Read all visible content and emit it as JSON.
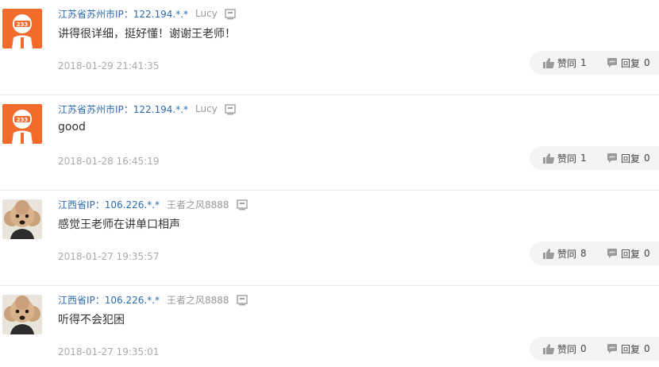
{
  "comments": [
    {
      "location": "江苏省苏州市IP：122.194.*.*",
      "username": "Lucy",
      "avatar_icon": "bilibili-233-avatar-icon",
      "content": "讲得很详细，挺好懂！谢谢王老师！",
      "time": "2018-01-29 21:41:35",
      "like_label": "赞同",
      "like_count": "1",
      "reply_label": "回复",
      "reply_count": "0"
    },
    {
      "location": "江苏省苏州市IP：122.194.*.*",
      "username": "Lucy",
      "avatar_icon": "bilibili-233-avatar-icon",
      "content": "good",
      "time": "2018-01-28 16:45:19",
      "like_label": "赞同",
      "like_count": "1",
      "reply_label": "回复",
      "reply_count": "0"
    },
    {
      "location": "江西省IP：106.226.*.*",
      "username": "王者之风8888",
      "avatar_icon": "poodle-dog-avatar-icon",
      "content": "感觉王老师在讲单口相声",
      "time": "2018-01-27 19:35:57",
      "like_label": "赞同",
      "like_count": "8",
      "reply_label": "回复",
      "reply_count": "0"
    },
    {
      "location": "江西省IP：106.226.*.*",
      "username": "王者之风8888",
      "avatar_icon": "poodle-dog-avatar-icon",
      "content": "听得不会犯困",
      "time": "2018-01-27 19:35:01",
      "like_label": "赞同",
      "like_count": "0",
      "reply_label": "回复",
      "reply_count": "0"
    }
  ],
  "colors": {
    "location_link": "#2b6bb0",
    "avatar_orange": "#f26b2a",
    "action_pill_bg": "#f4f4f4"
  }
}
